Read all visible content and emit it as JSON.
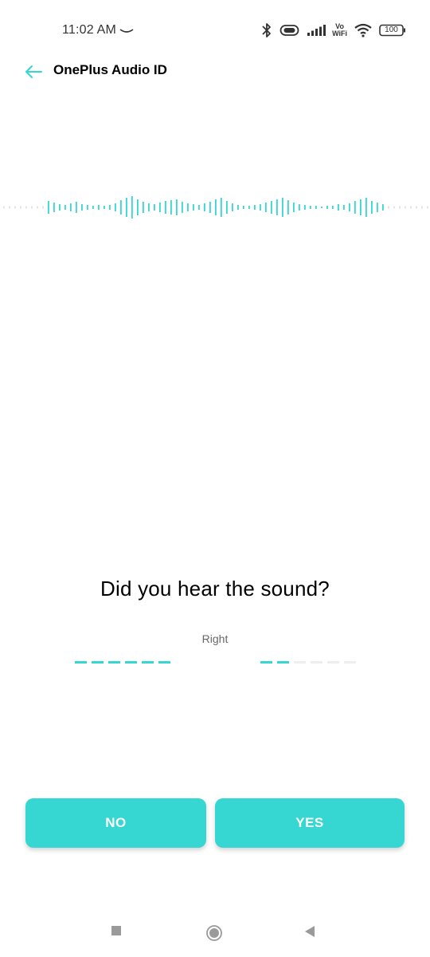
{
  "status_bar": {
    "time": "11:02 AM",
    "vowifi_top": "Vo",
    "vowifi_bottom": "WiFi",
    "battery": "100"
  },
  "app_bar": {
    "title": "OnePlus Audio ID"
  },
  "test": {
    "question": "Did you hear the sound?",
    "ear_label": "Right",
    "left_progress": {
      "filled": 6,
      "total": 6
    },
    "right_progress": {
      "filled": 2,
      "total": 6
    }
  },
  "buttons": {
    "no_label": "NO",
    "yes_label": "YES"
  },
  "colors": {
    "accent": "#36d6d3",
    "inactive_segment": "#eeeeee",
    "waveform_faint": "#e2e2e2"
  },
  "icons": [
    "bluetooth-icon",
    "battery-saver-icon",
    "signal-icon",
    "wifi-icon",
    "battery-icon",
    "back-arrow-icon",
    "recents-icon",
    "home-icon",
    "nav-back-icon"
  ]
}
